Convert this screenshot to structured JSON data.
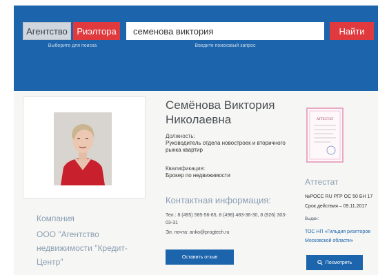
{
  "search": {
    "agency_label": "Агентство",
    "realtor_label": "Риэлтора",
    "type_hint": "Выберите для поиска",
    "query_value": "семенова виктория",
    "query_hint": "Введите поисковый запрос",
    "find_label": "Найти"
  },
  "profile": {
    "name": "Семёнова Виктория Николаевна",
    "position_label": "Должность:",
    "position_value": "Руководитель отдела новостроек и вторичного рынка квартир",
    "qualification_label": "Квалификация:",
    "qualification_value": "Брокер по недвижимости",
    "company_label": "Компания",
    "company_name": "ООО \"Агентство недвижимости \"Кредит-Центр\""
  },
  "contacts": {
    "title": "Контактная информация:",
    "phone": "Тел.: 8 (495) 585-56-65, 8 (498) 483-36-30, 8 (926) 303-03-31",
    "email": "Эл. почта: anko@progtech.ru",
    "review_button": "Оставить отзыв"
  },
  "attestat": {
    "title": "Аттестат",
    "certificate_number": "№РОСС RU РГР ОС 50 БН 17",
    "valid_until": "Срок действия – 09.11.2017",
    "issued_label": "Выдан:",
    "issued_value": "ТОС НП «Гильдия риэлторов Московской области»",
    "view_button": "Посмотреть",
    "thumb_text": "АТТЕСТАТ"
  }
}
